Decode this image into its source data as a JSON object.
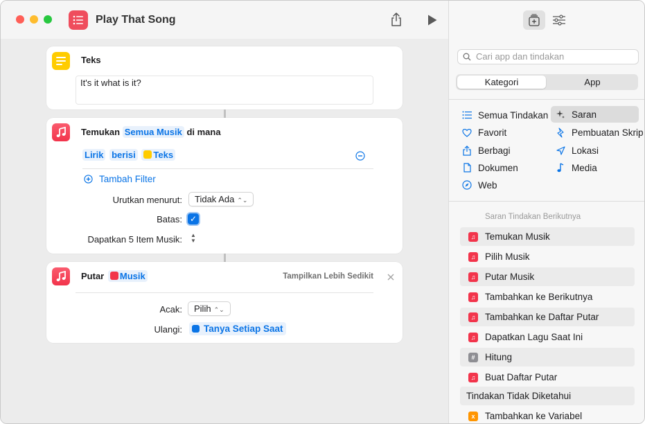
{
  "window": {
    "title": "Play That Song"
  },
  "actions": {
    "text_action": {
      "title": "Teks",
      "content": "It's it what is it?"
    },
    "find_action": {
      "title_prefix": "Temukan",
      "source_token": "Semua Musik",
      "title_suffix": "di mana",
      "filter": {
        "field": "Lirik",
        "operator": "berisi",
        "value": "Teks"
      },
      "add_filter_label": "Tambah Filter",
      "sort_label": "Urutkan menurut:",
      "sort_value": "Tidak Ada",
      "limit_label": "Batas:",
      "limit_checked": true,
      "get_label": "Dapatkan 5 Item Musik:"
    },
    "play_action": {
      "title": "Putar",
      "input_token": "Musik",
      "show_less_label": "Tampilkan Lebih Sedikit",
      "shuffle_label": "Acak:",
      "shuffle_value": "Pilih",
      "repeat_label": "Ulangi:",
      "repeat_value": "Tanya Setiap Saat"
    }
  },
  "sidebar": {
    "search_placeholder": "Cari app dan tindakan",
    "segments": [
      "Kategori",
      "App"
    ],
    "active_segment": "Kategori",
    "categories_left": [
      {
        "label": "Semua Tindakan",
        "icon": "list-icon"
      },
      {
        "label": "Favorit",
        "icon": "heart-icon"
      },
      {
        "label": "Berbagi",
        "icon": "share-icon"
      },
      {
        "label": "Dokumen",
        "icon": "document-icon"
      },
      {
        "label": "Web",
        "icon": "compass-icon"
      }
    ],
    "categories_right": [
      {
        "label": "Saran",
        "icon": "sparkle-icon"
      },
      {
        "label": "Pembuatan Skrip",
        "icon": "script-icon"
      },
      {
        "label": "Lokasi",
        "icon": "location-arrow-icon"
      },
      {
        "label": "Media",
        "icon": "music-note-icon"
      }
    ],
    "suggestions_heading": "Saran Tindakan Berikutnya",
    "suggestions": [
      {
        "label": "Temukan Musik",
        "icon": "music-app-icon",
        "color": "#f2344b"
      },
      {
        "label": "Pilih Musik",
        "icon": "music-app-icon",
        "color": "#f2344b"
      },
      {
        "label": "Putar Musik",
        "icon": "music-app-icon",
        "color": "#f2344b"
      },
      {
        "label": "Tambahkan ke Berikutnya",
        "icon": "music-app-icon",
        "color": "#f2344b"
      },
      {
        "label": "Tambahkan ke Daftar Putar",
        "icon": "music-app-icon",
        "color": "#f2344b"
      },
      {
        "label": "Dapatkan Lagu Saat Ini",
        "icon": "music-app-icon",
        "color": "#f2344b"
      },
      {
        "label": "Hitung",
        "icon": "hash-icon",
        "color": "#8e8e93"
      },
      {
        "label": "Buat Daftar Putar",
        "icon": "music-app-icon",
        "color": "#f2344b"
      }
    ],
    "unknown_heading": "Tindakan Tidak Diketahui",
    "unknown_item": {
      "label": "Tambahkan ke Variabel",
      "icon": "variable-icon",
      "color": "#ff9500"
    }
  }
}
